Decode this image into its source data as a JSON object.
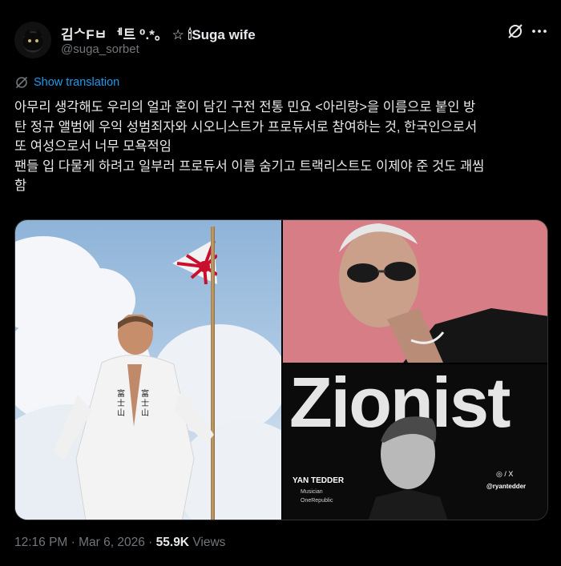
{
  "author": {
    "display_name": "김ᄉFㅂ ᅦ트 ⁰.*。 ☆ 🕯Suga wife",
    "handle": "@suga_sorbet"
  },
  "actions": {
    "grok_icon": "grok-slash-circle-icon",
    "more_icon": "more-horizontal-icon"
  },
  "translation": {
    "label": "Show translation",
    "icon": "globe-slash-icon"
  },
  "tweet": {
    "lines": [
      "아무리 생각해도 우리의 얼과 혼이 담긴 구전 전통 민요 <아리랑>을 이름으로 붙인 방",
      "탄 정규 앨범에 우익 성범죄자와 시오니스트가 프로듀서로 참여하는 것, 한국인으로서",
      "또 여성으로서 너무 모욕적임",
      "팬들 입 다물게 하려고 일부러 프로듀서 이름 숨기고 트랙리스트도 이제야 준 것도 괘씸",
      "함"
    ]
  },
  "media": {
    "left_image": {
      "robe_text_left": "富士山",
      "robe_text_right": "富士山"
    },
    "bottom_right_image": {
      "headline": "Zionist",
      "person_name": "YAN TEDDER",
      "role_line1": "Musician",
      "role_line2": "OneRepublic",
      "social_icons": "◎ / X",
      "social_handle": "@ryantedder"
    }
  },
  "meta": {
    "time": "12:16 PM",
    "separator": " · ",
    "date": "Mar 6, 2026",
    "views_count": "55.9K",
    "views_label": "Views"
  },
  "colors": {
    "background": "#000000",
    "text": "#e7e9ea",
    "secondary": "#71767b",
    "link": "#1d9bf0"
  }
}
